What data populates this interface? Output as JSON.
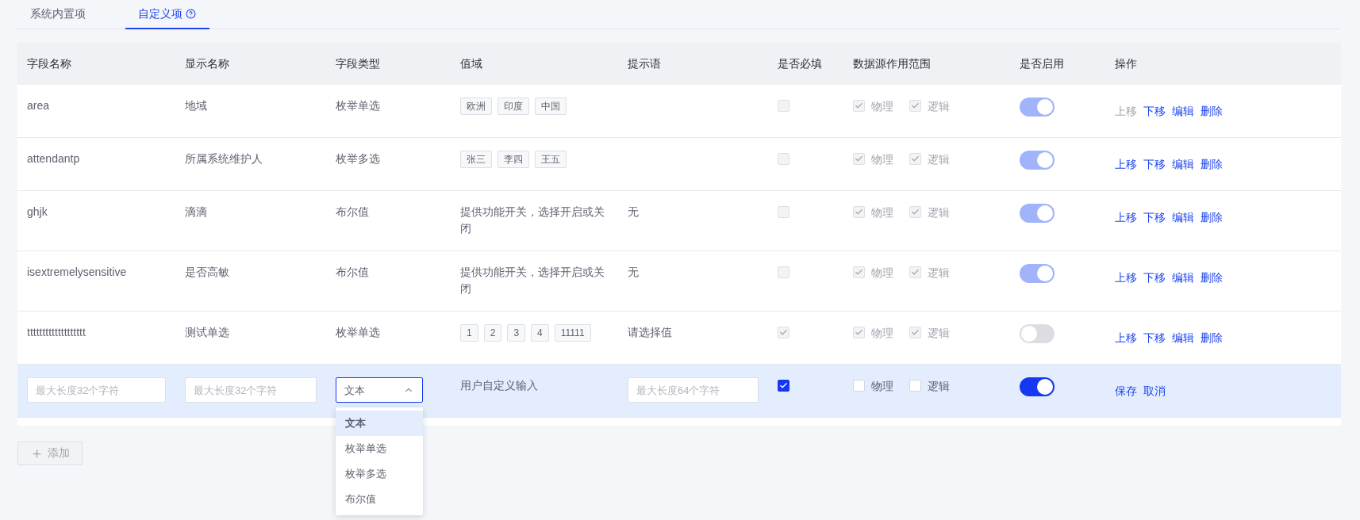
{
  "tabs": [
    {
      "label": "系统内置项",
      "selected": false,
      "help": false
    },
    {
      "label": "自定义项",
      "selected": true,
      "help": true
    }
  ],
  "table": {
    "columns": [
      "字段名称",
      "显示名称",
      "字段类型",
      "值域",
      "提示语",
      "是否必填",
      "数据源作用范围",
      "是否启用",
      "操作"
    ],
    "rows": [
      {
        "kind": "display",
        "field_name": "area",
        "display_name": "地域",
        "field_type": "枚举单选",
        "value_domain": {
          "kind": "tags",
          "tags": [
            "欧洲",
            "印度",
            "中国"
          ]
        },
        "hint": "",
        "required": {
          "checked": false,
          "disabled": true
        },
        "scope": [
          {
            "label": "物理",
            "checked": true,
            "disabled": true
          },
          {
            "label": "逻辑",
            "checked": true,
            "disabled": true
          }
        ],
        "enabled": {
          "on": true,
          "disabled": true
        },
        "actions": [
          {
            "label": "上移",
            "disabled": true
          },
          {
            "label": "下移",
            "disabled": false
          },
          {
            "label": "编辑",
            "disabled": false
          },
          {
            "label": "删除",
            "disabled": false
          }
        ]
      },
      {
        "kind": "display",
        "field_name": "attendantp",
        "display_name": "所属系统维护人",
        "field_type": "枚举多选",
        "value_domain": {
          "kind": "tags",
          "tags": [
            "张三",
            "李四",
            "王五"
          ]
        },
        "hint": "",
        "required": {
          "checked": false,
          "disabled": true
        },
        "scope": [
          {
            "label": "物理",
            "checked": true,
            "disabled": true
          },
          {
            "label": "逻辑",
            "checked": true,
            "disabled": true
          }
        ],
        "enabled": {
          "on": true,
          "disabled": true
        },
        "actions": [
          {
            "label": "上移",
            "disabled": false
          },
          {
            "label": "下移",
            "disabled": false
          },
          {
            "label": "编辑",
            "disabled": false
          },
          {
            "label": "删除",
            "disabled": false
          }
        ]
      },
      {
        "kind": "display",
        "field_name": "ghjk",
        "display_name": "滴滴",
        "field_type": "布尔值",
        "value_domain": {
          "kind": "text",
          "text": "提供功能开关，选择开启或关闭"
        },
        "hint": "无",
        "required": {
          "checked": false,
          "disabled": true
        },
        "scope": [
          {
            "label": "物理",
            "checked": true,
            "disabled": true
          },
          {
            "label": "逻辑",
            "checked": true,
            "disabled": true
          }
        ],
        "enabled": {
          "on": true,
          "disabled": true
        },
        "actions": [
          {
            "label": "上移",
            "disabled": false
          },
          {
            "label": "下移",
            "disabled": false
          },
          {
            "label": "编辑",
            "disabled": false
          },
          {
            "label": "删除",
            "disabled": false
          }
        ]
      },
      {
        "kind": "display",
        "field_name": "isextremelysensitive",
        "display_name": "是否高敏",
        "field_type": "布尔值",
        "value_domain": {
          "kind": "text",
          "text": "提供功能开关，选择开启或关闭"
        },
        "hint": "无",
        "required": {
          "checked": false,
          "disabled": true
        },
        "scope": [
          {
            "label": "物理",
            "checked": true,
            "disabled": true
          },
          {
            "label": "逻辑",
            "checked": true,
            "disabled": true
          }
        ],
        "enabled": {
          "on": true,
          "disabled": true
        },
        "actions": [
          {
            "label": "上移",
            "disabled": false
          },
          {
            "label": "下移",
            "disabled": false
          },
          {
            "label": "编辑",
            "disabled": false
          },
          {
            "label": "删除",
            "disabled": false
          }
        ]
      },
      {
        "kind": "display",
        "field_name": "ttttttttttttttttttt",
        "display_name": "测试单选",
        "field_type": "枚举单选",
        "value_domain": {
          "kind": "tags",
          "tags": [
            "1",
            "2",
            "3",
            "4",
            "11111"
          ]
        },
        "hint": "请选择值",
        "required": {
          "checked": true,
          "disabled": true
        },
        "scope": [
          {
            "label": "物理",
            "checked": true,
            "disabled": true
          },
          {
            "label": "逻辑",
            "checked": true,
            "disabled": true
          }
        ],
        "enabled": {
          "on": false,
          "disabled": true
        },
        "actions": [
          {
            "label": "上移",
            "disabled": false
          },
          {
            "label": "下移",
            "disabled": false
          },
          {
            "label": "编辑",
            "disabled": false
          },
          {
            "label": "删除",
            "disabled": false
          }
        ]
      },
      {
        "kind": "edit",
        "field_name": {
          "placeholder": "最大长度32个字符"
        },
        "display_name": {
          "placeholder": "最大长度32个字符"
        },
        "field_type": {
          "value": "文本",
          "expanded": true,
          "options": [
            {
              "label": "文本",
              "selected": true
            },
            {
              "label": "枚举单选",
              "selected": false
            },
            {
              "label": "枚举多选",
              "selected": false
            },
            {
              "label": "布尔值",
              "selected": false
            }
          ]
        },
        "value_domain": {
          "kind": "text",
          "text": "用户自定义输入"
        },
        "hint": {
          "placeholder": "最大长度64个字符"
        },
        "required": {
          "checked": true,
          "disabled": false
        },
        "scope": [
          {
            "label": "物理",
            "checked": false,
            "disabled": false
          },
          {
            "label": "逻辑",
            "checked": false,
            "disabled": false
          }
        ],
        "enabled": {
          "on": true,
          "disabled": false
        },
        "actions": [
          {
            "label": "保存",
            "disabled": false
          },
          {
            "label": "取消",
            "disabled": false
          }
        ]
      }
    ]
  },
  "add_button": {
    "label": "添加"
  }
}
